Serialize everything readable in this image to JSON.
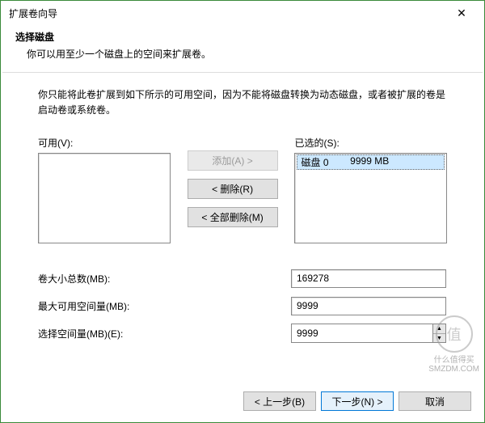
{
  "window": {
    "title": "扩展卷向导"
  },
  "header": {
    "title": "选择磁盘",
    "subtitle": "你可以用至少一个磁盘上的空间来扩展卷。"
  },
  "body": {
    "note": "你只能将此卷扩展到如下所示的可用空间，因为不能将磁盘转换为动态磁盘，或者被扩展的卷是启动卷或系统卷。",
    "available_label": "可用(V):",
    "selected_label": "已选的(S):",
    "selected_item": {
      "disk": "磁盘 0",
      "size": "9999 MB"
    },
    "buttons": {
      "add": "添加(A) >",
      "remove": "< 删除(R)",
      "remove_all": "< 全部删除(M)"
    },
    "fields": {
      "total_label": "卷大小总数(MB):",
      "total_value": "169278",
      "max_label": "最大可用空间量(MB):",
      "max_value": "9999",
      "select_label": "选择空间量(MB)(E):",
      "select_value": "9999"
    }
  },
  "footer": {
    "back": "< 上一步(B)",
    "next": "下一步(N) >",
    "cancel": "取消"
  },
  "watermark": {
    "char": "值",
    "text_top": "什么值得买",
    "text_bottom": "SMZDM.COM"
  }
}
